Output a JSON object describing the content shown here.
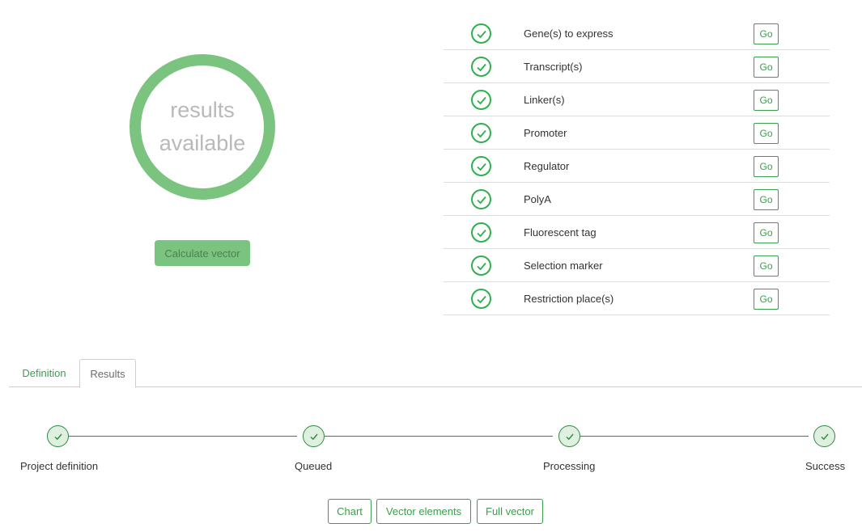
{
  "status": {
    "line1": "results",
    "line2": "available",
    "ring_color": "#7bc47f",
    "calculate_label": "Calculate vector"
  },
  "checklist": {
    "icon": "check-circle-icon",
    "accent": "#2fb04f",
    "go_label": "Go",
    "items": [
      {
        "label": "Gene(s) to express",
        "done": true
      },
      {
        "label": "Transcript(s)",
        "done": true
      },
      {
        "label": "Linker(s)",
        "done": true
      },
      {
        "label": "Promoter",
        "done": true
      },
      {
        "label": "Regulator",
        "done": true
      },
      {
        "label": "PolyA",
        "done": true
      },
      {
        "label": "Fluorescent tag",
        "done": true
      },
      {
        "label": "Selection marker",
        "done": true
      },
      {
        "label": "Restriction place(s)",
        "done": true
      }
    ]
  },
  "tabs": [
    {
      "label": "Definition",
      "active": false
    },
    {
      "label": "Results",
      "active": true
    }
  ],
  "steps": [
    {
      "label": "Project definition",
      "done": true
    },
    {
      "label": "Queued",
      "done": true
    },
    {
      "label": "Processing",
      "done": true
    },
    {
      "label": "Success",
      "done": true
    }
  ],
  "result_buttons": {
    "chart": "Chart",
    "vector_elements": "Vector elements",
    "full_vector": "Full vector"
  }
}
